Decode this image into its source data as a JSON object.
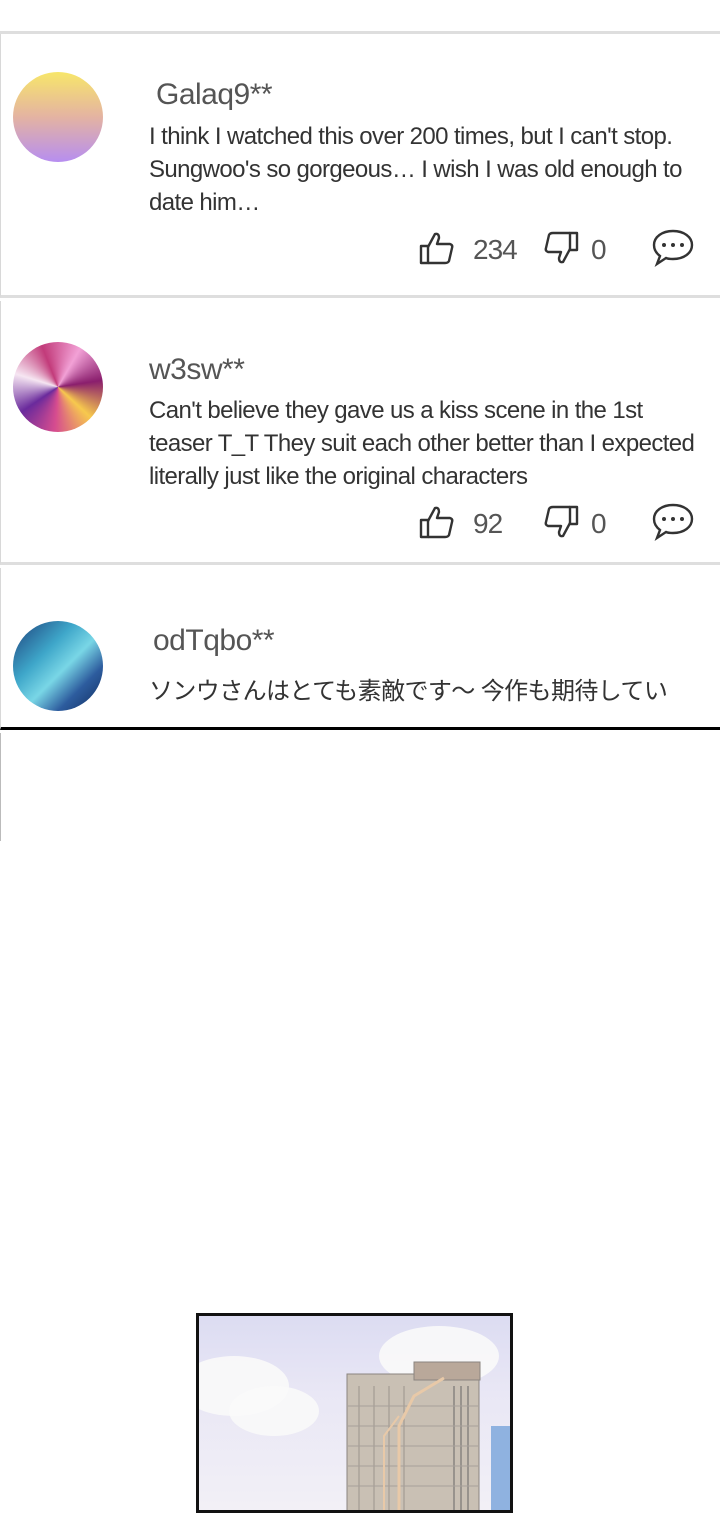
{
  "comments": [
    {
      "username": "Galaq9**",
      "text": "I think I watched this over 200 times, but I can't stop. Sungwoo's so gorgeous… I wish I was old enough to date him…",
      "likes": "234",
      "dislikes": "0"
    },
    {
      "username": "w3sw**",
      "text": "Can't believe they gave us a kiss scene in the 1st teaser T_T They suit each other better than I expected literally just like the original characters",
      "likes": "92",
      "dislikes": "0"
    },
    {
      "username": "odTqbo**",
      "text": "ソンウさんはとても素敵です～ 今作も期待してい"
    }
  ],
  "icons": {
    "like": "thumbs-up-icon",
    "dislike": "thumbs-down-icon",
    "reply": "speech-bubble-icon"
  },
  "colors": {
    "text": "#333333",
    "username": "#555555",
    "divider": "#dedede"
  }
}
